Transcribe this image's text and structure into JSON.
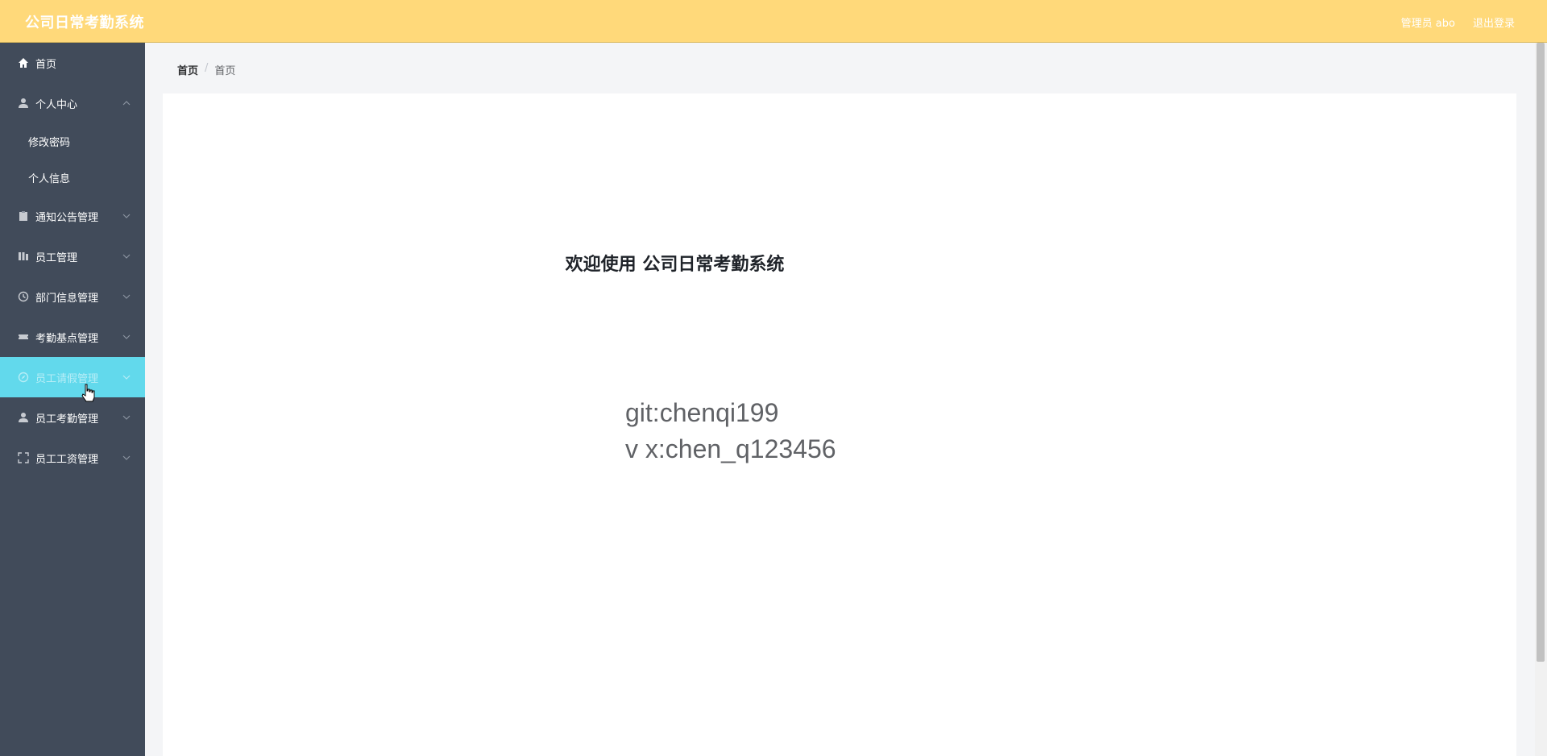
{
  "header": {
    "title": "公司日常考勤系统",
    "user_label": "管理员 abo",
    "logout_label": "退出登录"
  },
  "colors": {
    "header_bg": "#ffd97a",
    "sidebar_bg": "#414b5a",
    "active_bg": "#62d9ec"
  },
  "sidebar": {
    "items": [
      {
        "label": "首页",
        "icon": "home-icon"
      },
      {
        "label": "个人中心",
        "icon": "user-icon",
        "expanded": true,
        "children": [
          {
            "label": "修改密码"
          },
          {
            "label": "个人信息"
          }
        ]
      },
      {
        "label": "通知公告管理",
        "icon": "clipboard-icon"
      },
      {
        "label": "员工管理",
        "icon": "bars-icon"
      },
      {
        "label": "部门信息管理",
        "icon": "clock-icon"
      },
      {
        "label": "考勤基点管理",
        "icon": "ticket-icon"
      },
      {
        "label": "员工请假管理",
        "icon": "compass-icon",
        "active": true
      },
      {
        "label": "员工考勤管理",
        "icon": "user-icon"
      },
      {
        "label": "员工工资管理",
        "icon": "fullscreen-icon"
      }
    ]
  },
  "breadcrumb": {
    "items": [
      "首页",
      "首页"
    ],
    "separator": "/"
  },
  "main": {
    "welcome": "欢迎使用 公司日常考勤系统",
    "git": "git:chenqi199",
    "vx": "v x:chen_q123456"
  }
}
